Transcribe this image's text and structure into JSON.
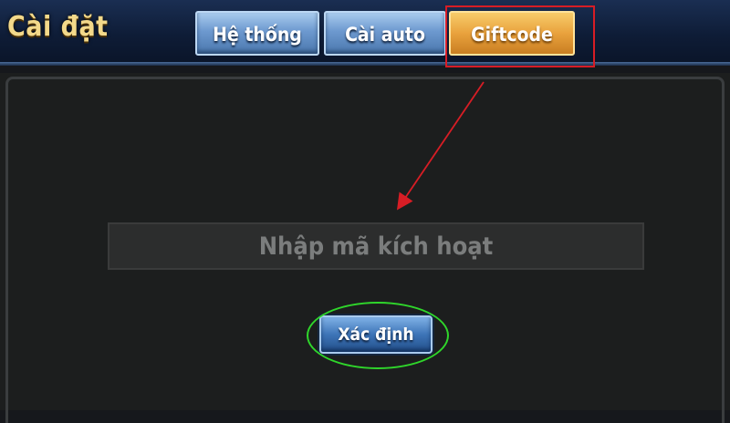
{
  "header": {
    "title": "Cài đặt",
    "tabs": [
      {
        "label": "Hệ thống",
        "active": false
      },
      {
        "label": "Cài auto",
        "active": false
      },
      {
        "label": "Giftcode",
        "active": true
      }
    ]
  },
  "giftcode": {
    "input_placeholder": "Nhập mã kích hoạt",
    "input_value": "",
    "confirm_label": "Xác định"
  },
  "annotation_colors": {
    "box": "#d71d25",
    "arrow": "#d71d25",
    "ellipse": "#2fd62b"
  }
}
